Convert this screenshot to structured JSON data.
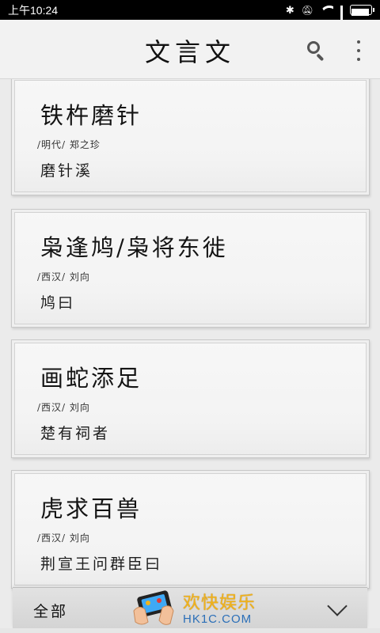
{
  "status_bar": {
    "time": "上午10:24",
    "icons": [
      "bluetooth-icon",
      "mute-icon",
      "wifi-icon",
      "signal-icon",
      "battery-icon"
    ]
  },
  "header": {
    "title": "文言文",
    "icons": [
      "search-icon",
      "more-vert-icon"
    ]
  },
  "articles": [
    {
      "title": "铁杵磨针",
      "meta": "/明代/ 郑之珍",
      "first_line": "磨针溪"
    },
    {
      "title": "枭逢鸠/枭将东徙",
      "meta": "/西汉/ 刘向",
      "first_line": "鸠曰"
    },
    {
      "title": "画蛇添足",
      "meta": "/西汉/ 刘向",
      "first_line": "楚有祠者"
    },
    {
      "title": "虎求百兽",
      "meta": "/西汉/ 刘向",
      "first_line": "荆宣王问群臣曰"
    }
  ],
  "filter": {
    "label": "全部",
    "icon": "chevron-down-icon"
  },
  "watermark": {
    "text": "欢快娱乐",
    "url": "HK1C.COM"
  },
  "colors": {
    "background": "#ebebeb",
    "header": "#f2f2f2",
    "text": "#1e1e1e",
    "watermark_gold": "#f1b31a",
    "watermark_blue": "#2b6fb8"
  }
}
